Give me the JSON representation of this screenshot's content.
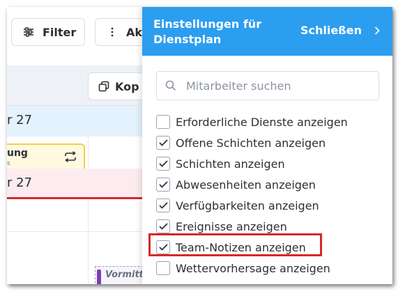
{
  "toolbar": {
    "filter_label": "Filter",
    "filter_icon": "sliders-icon",
    "actions_label": "Akt",
    "actions_icon": "vertical-ellipsis-icon"
  },
  "calendar": {
    "copy_label": "Kop",
    "copy_icon": "copy-icon",
    "day1_label": "r 27",
    "day2_label": "r 27",
    "shift_label": "ung",
    "shift_sub": "s",
    "shift_icon": "repeat-icon",
    "draft_label": "Vormitt"
  },
  "panel": {
    "title": "Einstellungen für Dienstplan",
    "close_label": "Schließen",
    "close_icon": "chevron-right-icon",
    "search_placeholder": "Mitarbeiter suchen",
    "search_value": "",
    "options": [
      {
        "label": "Erforderliche Dienste anzeigen",
        "checked": false
      },
      {
        "label": "Offene Schichten anzeigen",
        "checked": true
      },
      {
        "label": "Schichten anzeigen",
        "checked": true
      },
      {
        "label": "Abwesenheiten anzeigen",
        "checked": true
      },
      {
        "label": "Verfügbarkeiten anzeigen",
        "checked": true
      },
      {
        "label": "Ereignisse anzeigen",
        "checked": true
      },
      {
        "label": "Team-Notizen anzeigen",
        "checked": true
      },
      {
        "label": "Wettervorhersage anzeigen",
        "checked": false
      }
    ]
  },
  "colors": {
    "panel_header": "#2b9ef0",
    "highlight": "#d42a2a",
    "day1_bg": "#e4f2fd",
    "day2_bg": "#fdecef",
    "shift_border": "#f0cf49"
  }
}
